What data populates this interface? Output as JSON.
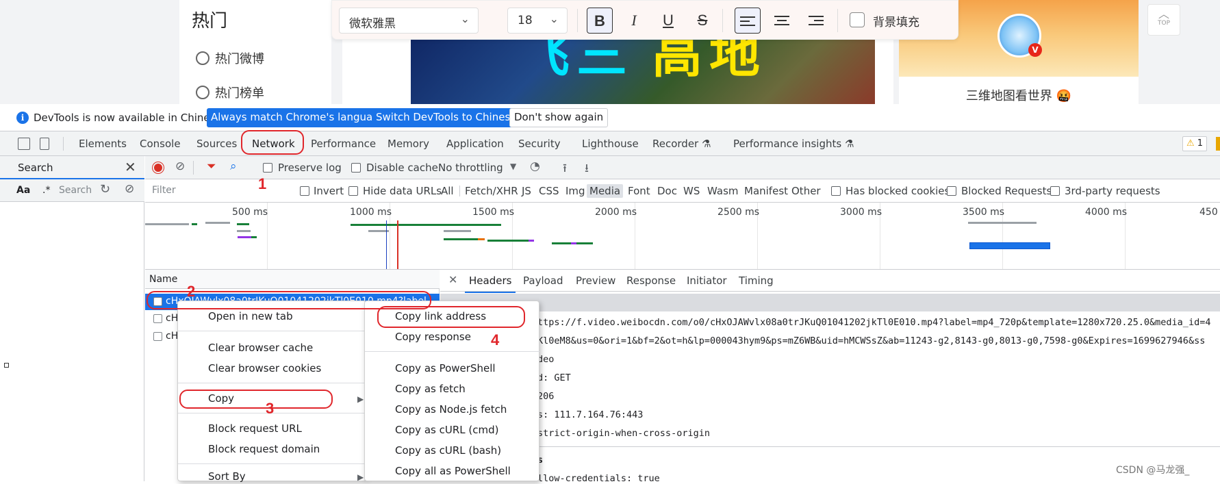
{
  "webpage": {
    "left_title": "热门",
    "left_items": [
      "热门微博",
      "热门榜单"
    ],
    "video_text": [
      "飞三",
      "高地"
    ],
    "card_caption": "三维地图看世界 🤬",
    "top_button": "TOP",
    "avatar_badge": "V"
  },
  "format_toolbar": {
    "font_family": "微软雅黑",
    "font_size": "18",
    "bold": "B",
    "italic": "I",
    "underline": "U",
    "strike": "S",
    "bg_fill_label": "背景填充"
  },
  "infobar": {
    "message": "DevTools is now available in Chinese!",
    "btn_match": "Always match Chrome's language",
    "btn_switch": "Switch DevTools to Chinese",
    "btn_dismiss": "Don't show again"
  },
  "tabs": [
    "Elements",
    "Console",
    "Sources",
    "Network",
    "Performance",
    "Memory",
    "Application",
    "Security",
    "Lighthouse",
    "Recorder",
    "Performance insights"
  ],
  "warning_count": "1",
  "search_panel": {
    "title": "Search",
    "case_label": "Aa",
    "regex_label": ".*",
    "placeholder": "Search"
  },
  "net_toolbar": {
    "preserve_log": "Preserve log",
    "disable_cache": "Disable cache",
    "throttling": "No throttling"
  },
  "filter_bar": {
    "placeholder": "Filter",
    "invert": "Invert",
    "hide_data_urls": "Hide data URLs",
    "types": [
      "All",
      "Fetch/XHR",
      "JS",
      "CSS",
      "Img",
      "Media",
      "Font",
      "Doc",
      "WS",
      "Wasm",
      "Manifest",
      "Other"
    ],
    "selected_type": "Media",
    "has_blocked_cookies": "Has blocked cookies",
    "blocked_requests": "Blocked Requests",
    "third_party": "3rd-party requests"
  },
  "timeline": {
    "labels": [
      "500 ms",
      "1000 ms",
      "1500 ms",
      "2000 ms",
      "2500 ms",
      "3000 ms",
      "3500 ms",
      "4000 ms",
      "450"
    ]
  },
  "requests": {
    "header": "Name",
    "rows": [
      "cHxOJAWvlx08a0trJKuQ01041202jkTl0E010.mp4?label",
      "cH",
      "cH"
    ]
  },
  "detail": {
    "tabs": [
      "Headers",
      "Payload",
      "Preview",
      "Response",
      "Initiator",
      "Timing"
    ],
    "selected_tab": "Headers",
    "lines": [
      "ttps://f.video.weibocdn.com/o0/cHxOJAWvlx08a0trJKuQ01041202jkTl0E010.mp4?label=mp4_720p&template=1280x720.25.0&media_id=4",
      "Kl0eM8&us=0&ori=1&bf=2&ot=h&lp=000043hym9&ps=mZ6WB&uid=hMCWSsZ&ab=11243-g2,8143-g0,8013-g0,7598-g0&Expires=1699627946&ss",
      "deo",
      "d: GET",
      "206",
      "s: 111.7.164.76:443",
      "strict-origin-when-cross-origin",
      "s",
      "llow-credentials: true"
    ]
  },
  "context_menu": {
    "items": [
      "Open in new tab",
      "Clear browser cache",
      "Clear browser cookies",
      "Copy",
      "Block request URL",
      "Block request domain",
      "Sort By"
    ]
  },
  "copy_submenu": {
    "items": [
      "Copy link address",
      "Copy response",
      "Copy as PowerShell",
      "Copy as fetch",
      "Copy as Node.js fetch",
      "Copy as cURL (cmd)",
      "Copy as cURL (bash)",
      "Copy all as PowerShell"
    ]
  },
  "annotations": [
    "1",
    "2",
    "3",
    "4"
  ],
  "watermark": "CSDN @马龙强_",
  "colors": {
    "accent": "#1a73e8",
    "annotation": "#e0262b",
    "record": "#d93025"
  }
}
